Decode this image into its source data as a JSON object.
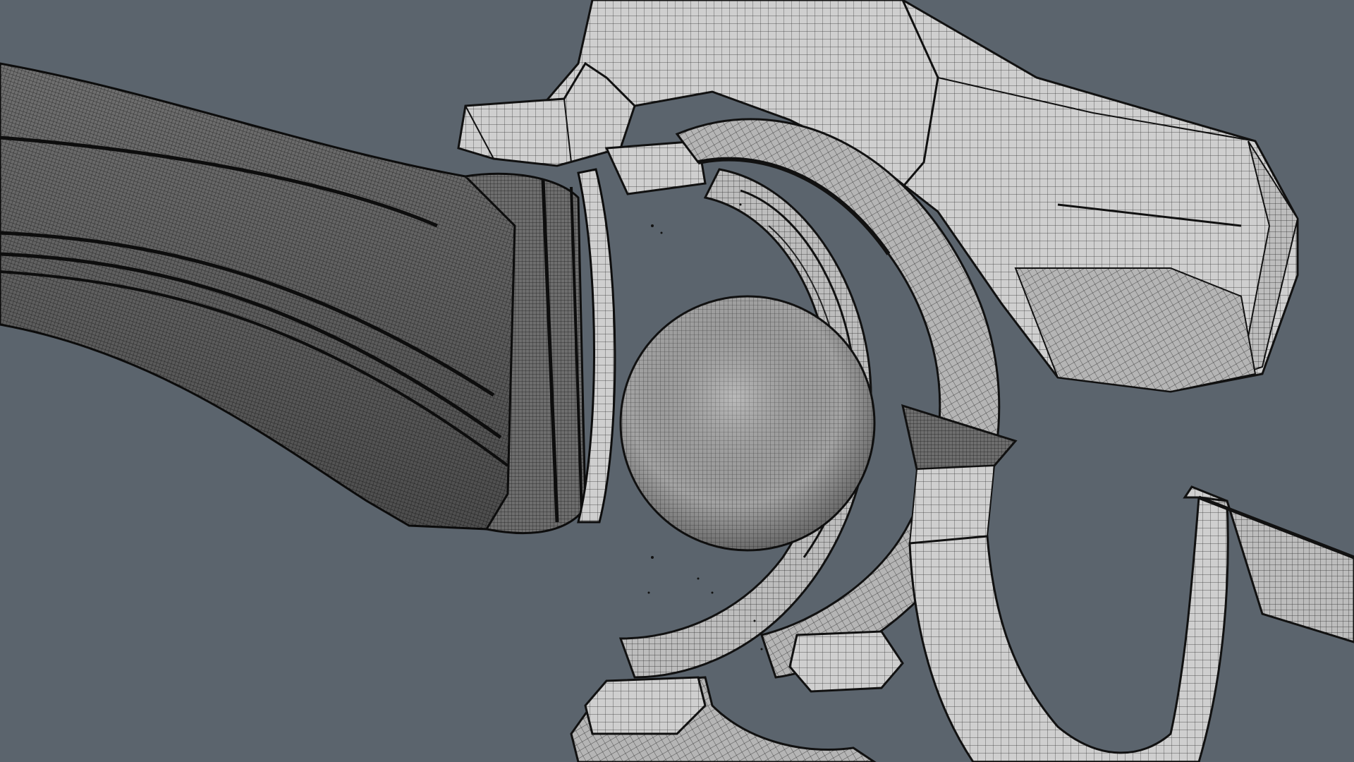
{
  "viewport": {
    "background": "#5b646d",
    "render_style": "wireframe-on-shaded",
    "objects": [
      {
        "name": "handle-arm",
        "tone": "dark-grey"
      },
      {
        "name": "upper-housing",
        "tone": "light-grey"
      },
      {
        "name": "ring-outer",
        "tone": "light-grey"
      },
      {
        "name": "ring-inner",
        "tone": "light-grey"
      },
      {
        "name": "sphere",
        "tone": "mid-grey"
      },
      {
        "name": "blade",
        "tone": "light-grey"
      },
      {
        "name": "curved-prong",
        "tone": "light-grey"
      },
      {
        "name": "lower-clamp",
        "tone": "light-grey"
      }
    ]
  },
  "colors": {
    "background": "#5b646d",
    "wire_dark": "#1a1a1a",
    "surface_light": "#c9c9c9",
    "surface_mid": "#a8a8a8",
    "surface_dark": "#5a5a5a",
    "edge": "#0d0d0d"
  }
}
